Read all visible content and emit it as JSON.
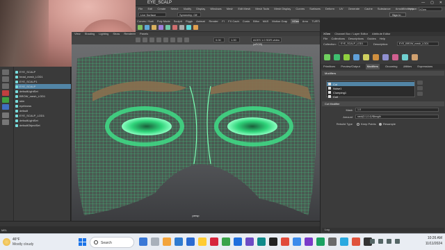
{
  "window": {
    "title": "EYE_SCALP",
    "controls": [
      "—",
      "▢",
      "✕"
    ]
  },
  "menubar": {
    "items": [
      "File",
      "Edit",
      "Create",
      "Select",
      "Modify",
      "Display",
      "Windows",
      "Mesh",
      "Edit Mesh",
      "Mesh Tools",
      "Mesh Display",
      "Curves",
      "Surfaces",
      "Deform",
      "UV",
      "Generate",
      "Cache",
      "Substance",
      "Arnold",
      "Help"
    ],
    "workspace_label": "Workspace:",
    "workspace_value": "XGen"
  },
  "status_line": {
    "mode": "Live Surface",
    "symmetry": "Symmetry: Off",
    "sign_in": "Sign In"
  },
  "shelf": {
    "tabs": [
      "Curves / Surfaces",
      "Poly Modeling",
      "Sculpting",
      "Rigging",
      "Animation",
      "Rendering",
      "FX",
      "FX Caching",
      "Custom",
      "Bifrost",
      "MASH",
      "Motion Graphics",
      "XGen",
      "Arnold",
      "TURTLE"
    ],
    "active_tab": "XGen"
  },
  "outliner": {
    "items": [
      {
        "label": "EYE_SCALP",
        "selected": false
      },
      {
        "label": "head_mesh_LOD1",
        "selected": false
      },
      {
        "label": "EYE_SCALP1",
        "selected": false
      },
      {
        "label": "EYE_SCALP",
        "selected": true
      },
      {
        "label": "defaultLightSet",
        "selected": false
      },
      {
        "label": "BROW_mesh_LOD1",
        "selected": false
      },
      {
        "label": "skin",
        "selected": false
      },
      {
        "label": "eyebrows",
        "selected": false
      },
      {
        "label": "default",
        "selected": false
      },
      {
        "label": "EYE_SCALP_LOD1",
        "selected": false
      },
      {
        "label": "defaultLightSet",
        "selected": false
      },
      {
        "label": "defaultObjectSet",
        "selected": false
      }
    ]
  },
  "viewport": {
    "menus": [
      "View",
      "Shading",
      "Lighting",
      "Show",
      "Renderer",
      "Panels"
    ],
    "field_value_1": "0.00",
    "field_value_2": "1.00",
    "color_space": "ACES 1.0 SDR-video (sRGB)",
    "camera_label": "Camera Look Here",
    "persp_label": "persp"
  },
  "right_panel": {
    "tabs": [
      "XGen",
      "Channel Box / Layer Editor",
      "Attribute Editor"
    ],
    "active_tab": "XGen",
    "menus": [
      "File",
      "Collections",
      "Descriptions",
      "Guides",
      "Help"
    ],
    "collection_label": "Collection:",
    "collection_value": "EYE_SCALP_LOD1",
    "description_label": "Description:",
    "description_value": "EYE_BROW_mesh_LOD1",
    "subtabs": [
      "Primitives",
      "Preview/Output",
      "Modifiers",
      "Grooming",
      "Utilities",
      "Expressions"
    ],
    "active_subtab": "Modifiers",
    "modifiers_header": "Modifiers",
    "modifiers": [
      {
        "label": "Cut",
        "selected": true
      },
      {
        "label": "Noise1",
        "selected": false
      },
      {
        "label": "Clumping1",
        "selected": false
      },
      {
        "label": "Coil",
        "selected": false
      }
    ],
    "cut_header": "Cut Modifier",
    "mask_label": "Mask",
    "mask_value": "1.0",
    "amount_label": "Amount",
    "amount_value": "rand(0.1,0.4)*$length",
    "rebuild_label": "Rebuild Type",
    "rebuild_options": [
      "Keep Points",
      "Resample"
    ],
    "rebuild_selected": "Resample",
    "bottom_label": "Log"
  },
  "time_slider": {
    "mel_label": "MEL"
  },
  "taskbar": {
    "temperature": "46°F",
    "condition": "Mostly cloudy",
    "search_placeholder": "Search",
    "time": "10:26 AM",
    "date": "11/11/2024",
    "app_colors": [
      "#3a78d6",
      "#a8b0ba",
      "#f3a43b",
      "#2f7bd0",
      "#2a6ad1",
      "#ffcc33",
      "#d7263d",
      "#3aa34a",
      "#1f6fdd",
      "#6d4bc4",
      "#0f8a8a",
      "#222",
      "#e14b3b",
      "#3b8beb",
      "#7a3ac9",
      "#1aa262",
      "#6a6a6a",
      "#29a9e0",
      "#e0533c",
      "#333"
    ]
  },
  "colors": {
    "wire": "#3ee38a",
    "selection": "#5285a6",
    "accent": "#1a73e8"
  }
}
